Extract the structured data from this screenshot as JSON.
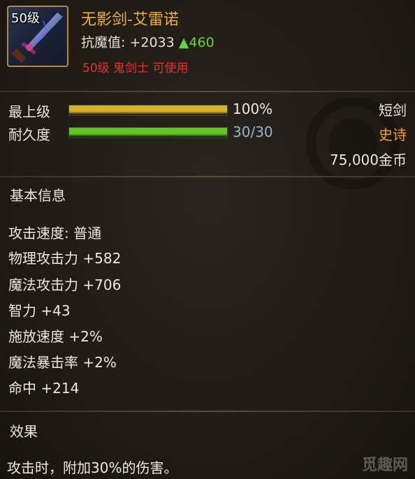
{
  "item": {
    "level_badge": "50级",
    "name": "无影剑-艾雷诺",
    "resist_label": "抗魔值:",
    "resist_value": "+2033",
    "resist_bonus": "▲460",
    "requirement": "50级 鬼剑士 可使用",
    "icon": "sword-icon"
  },
  "bars": [
    {
      "label": "最上级",
      "value_text": "100%",
      "fraction": 1.0,
      "color": "#d6b224"
    },
    {
      "label": "耐久度",
      "value_text": "30/30",
      "fraction": 1.0,
      "color": "#5fc81f"
    }
  ],
  "side": {
    "type": "短剑",
    "rarity": "史诗",
    "rarity_color": "#f0a020",
    "price": "75,000金币"
  },
  "basic_info": {
    "title": "基本信息",
    "stats": [
      "攻击速度: 普通",
      "物理攻击力 +582",
      "魔法攻击力 +706",
      "智力 +43",
      "施放速度 +2%",
      "魔法暴击率 +2%",
      "命中 +214"
    ]
  },
  "effect": {
    "title": "效果",
    "text": "攻击时，附加30%的伤害。"
  },
  "watermark": "觅趣网"
}
